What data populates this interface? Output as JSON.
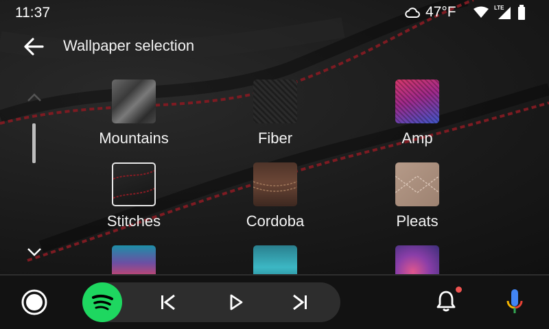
{
  "status": {
    "time": "11:37",
    "temperature": "47°F",
    "network": "LTE"
  },
  "appbar": {
    "title": "Wallpaper selection",
    "back_icon": "back-arrow-icon"
  },
  "wallpapers": [
    {
      "label": "Mountains",
      "selected": false
    },
    {
      "label": "Fiber",
      "selected": false
    },
    {
      "label": "Amp",
      "selected": false
    },
    {
      "label": "Stitches",
      "selected": true
    },
    {
      "label": "Cordoba",
      "selected": false
    },
    {
      "label": "Pleats",
      "selected": false
    },
    {
      "label": "",
      "selected": false
    },
    {
      "label": "",
      "selected": false
    },
    {
      "label": "",
      "selected": false
    }
  ],
  "colors": {
    "spotify": "#1ed760",
    "notification_dot": "#ef5350",
    "stitch": "#8a1c24"
  },
  "navbar": {
    "home_icon": "home-circle-icon",
    "app_icon": "spotify-icon",
    "controls": [
      "skip-previous-icon",
      "play-icon",
      "skip-next-icon"
    ],
    "notification_icon": "bell-icon",
    "assistant_icon": "microphone-icon"
  }
}
